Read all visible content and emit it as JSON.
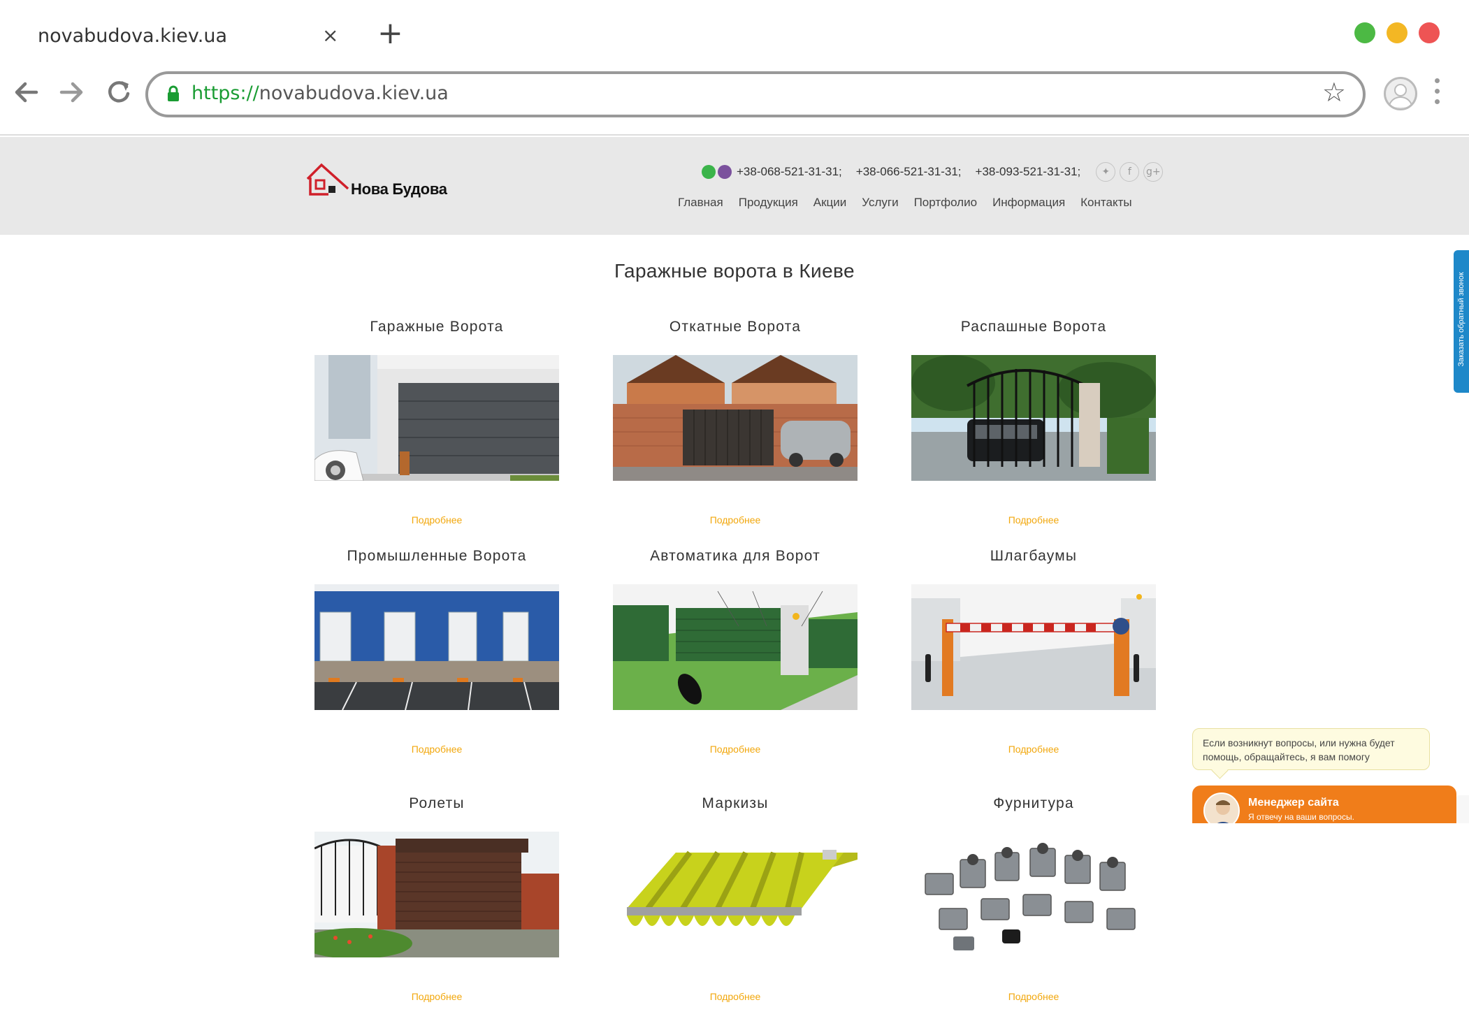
{
  "browser": {
    "tab_title": "novabudova.kiev.ua",
    "tab_close": "×",
    "new_tab": "+",
    "url_scheme": "https://",
    "url_host": "novabudova.kiev.ua",
    "window_controls": {
      "green": "#4cb944",
      "yellow": "#f3b724",
      "red": "#ee5454"
    }
  },
  "header": {
    "logo_text": "Нова Будова",
    "phones": [
      "+38-068-521-31-31;",
      "+38-066-521-31-31;",
      "+38-093-521-31-31;"
    ],
    "social": [
      "twitter-icon",
      "facebook-icon",
      "google-plus-icon"
    ],
    "nav": [
      "Главная",
      "Продукция",
      "Акции",
      "Услуги",
      "Портфолио",
      "Информация",
      "Контакты"
    ]
  },
  "main": {
    "title": "Гаражные ворота в Киеве",
    "more_label": "Подробнее",
    "cards": [
      {
        "title": "Гаражные Ворота"
      },
      {
        "title": "Откатные Ворота"
      },
      {
        "title": "Распашные Ворота"
      },
      {
        "title": "Промышленные Ворота"
      },
      {
        "title": "Автоматика для Ворот"
      },
      {
        "title": "Шлагбаумы"
      },
      {
        "title": "Ролеты"
      },
      {
        "title": "Маркизы"
      },
      {
        "title": "Фурнитура"
      }
    ]
  },
  "widgets": {
    "callback_tab": "Заказать обратный звонок",
    "chat_bubble": "Если возникнут вопросы, или нужна будет помощь, обращайтесь, я вам помогу",
    "chat_name": "Менеджер сайта",
    "chat_sub": "Я отвечу на ваши вопросы."
  },
  "colors": {
    "accent_more": "#f2a70c",
    "logo_red": "#d0202a",
    "chat_orange": "#f07d1a",
    "callback_blue": "#1e88c9"
  }
}
